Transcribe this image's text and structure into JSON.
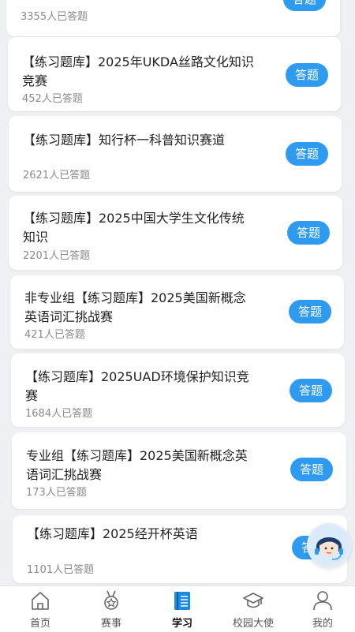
{
  "items": [
    {
      "title": "",
      "count": "3355人已答题",
      "button": "答题"
    },
    {
      "title": "【练习题库】2025年UKDA丝路文化知识竞赛",
      "count": "452人已答题",
      "button": "答题"
    },
    {
      "title": "【练习题库】知行杯一科普知识赛道",
      "count": "2621人已答题",
      "button": "答题"
    },
    {
      "title": "【练习题库】2025中国大学生文化传统知识",
      "count": "2201人已答题",
      "button": "答题"
    },
    {
      "title": "非专业组【练习题库】2025美国新概念英语词汇挑战赛",
      "count": "421人已答题",
      "button": "答题"
    },
    {
      "title": "【练习题库】2025UAD环境保护知识竞赛",
      "count": "1684人已答题",
      "button": "答题"
    },
    {
      "title": "专业组【练习题库】2025美国新概念英语词汇挑战赛",
      "count": "173人已答题",
      "button": "答题"
    },
    {
      "title": "【练习题库】2025经开杯英语",
      "count": "1101人已答题",
      "button": "答题"
    }
  ],
  "tabs": [
    {
      "label": "首页",
      "icon": "home-icon"
    },
    {
      "label": "赛事",
      "icon": "medal-icon"
    },
    {
      "label": "学习",
      "icon": "book-icon"
    },
    {
      "label": "校园大使",
      "icon": "graduation-cap-icon"
    },
    {
      "label": "我的",
      "icon": "user-icon"
    }
  ],
  "colors": {
    "accent": "#2e9bf0",
    "active_tab": "#1d8bdf"
  }
}
